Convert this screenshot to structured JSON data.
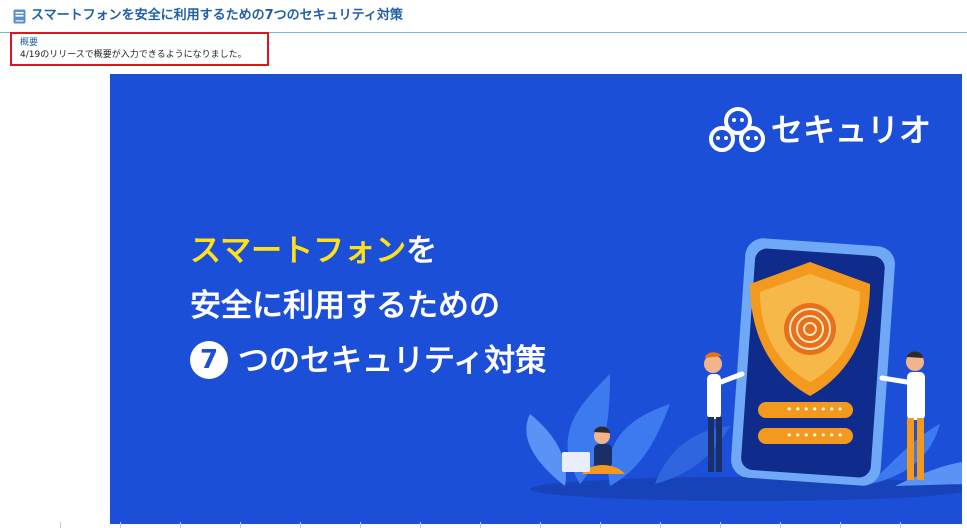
{
  "page": {
    "title": "スマートフォンを安全に利用するための7つのセキュリティ対策",
    "icon": "book-icon"
  },
  "summary": {
    "label": "概要",
    "text": "4/19のリリースで概要が入力できるようになりました。",
    "highlight_color": "#e0141e"
  },
  "banner": {
    "brand_name": "セキュリオ",
    "headline_line1_highlight": "スマートフォン",
    "headline_line1_rest": "を",
    "headline_line2": "安全に利用するための",
    "headline_number": "7",
    "headline_line3": "つのセキュリティ対策",
    "password_dots": "•••••••",
    "colors": {
      "background": "#1c4fd8",
      "highlight": "#ffe01a",
      "accent": "#f39a1e"
    }
  }
}
